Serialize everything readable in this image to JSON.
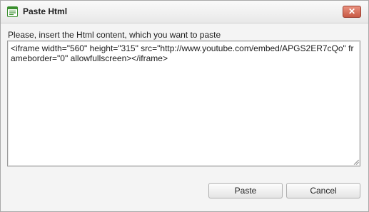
{
  "dialog": {
    "title": "Paste Html",
    "title_icon": "paste-html-icon",
    "close_icon": "close-icon",
    "close_glyph": "✕",
    "prompt": "Please, insert the Html content, which you want to paste",
    "content": "<iframe width=\"560\" height=\"315\" src=\"http://www.youtube.com/embed/APGS2ER7cQo\" frameborder=\"0\" allowfullscreen></iframe>",
    "paste_label": "Paste",
    "cancel_label": "Cancel"
  },
  "colors": {
    "close_button": "#d6705c",
    "icon_green": "#3a8f2e"
  }
}
